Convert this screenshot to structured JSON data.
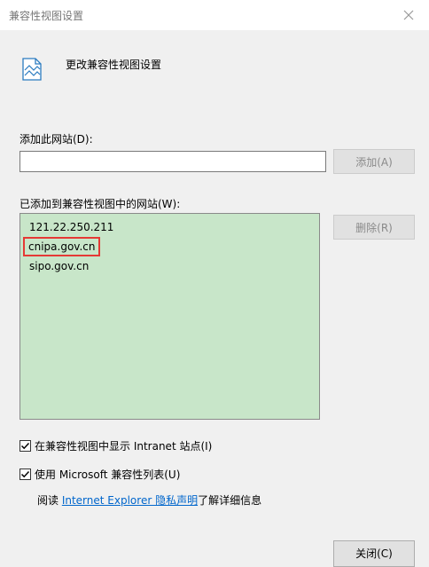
{
  "window": {
    "title": "兼容性视图设置",
    "close_glyph": "✕"
  },
  "header": {
    "text": "更改兼容性视图设置",
    "icon": "compat-settings-icon"
  },
  "add_site": {
    "label": "添加此网站(D):",
    "value": "",
    "button_label": "添加(A)"
  },
  "added_sites": {
    "label": "已添加到兼容性视图中的网站(W):",
    "items": [
      "121.22.250.211",
      "cnipa.gov.cn",
      "sipo.gov.cn"
    ],
    "highlight_color": "#e53935",
    "remove_button_label": "删除(R)",
    "list_bg": "#c8e6c9"
  },
  "options": [
    {
      "label": "在兼容性视图中显示 Intranet 站点(I)",
      "checked": true
    },
    {
      "label": "使用 Microsoft 兼容性列表(U)",
      "checked": true
    }
  ],
  "info": {
    "prefix": "阅读 ",
    "link_text": "Internet Explorer 隐私声明",
    "suffix": "了解详细信息"
  },
  "footer": {
    "close_button_label": "关闭(C)"
  }
}
